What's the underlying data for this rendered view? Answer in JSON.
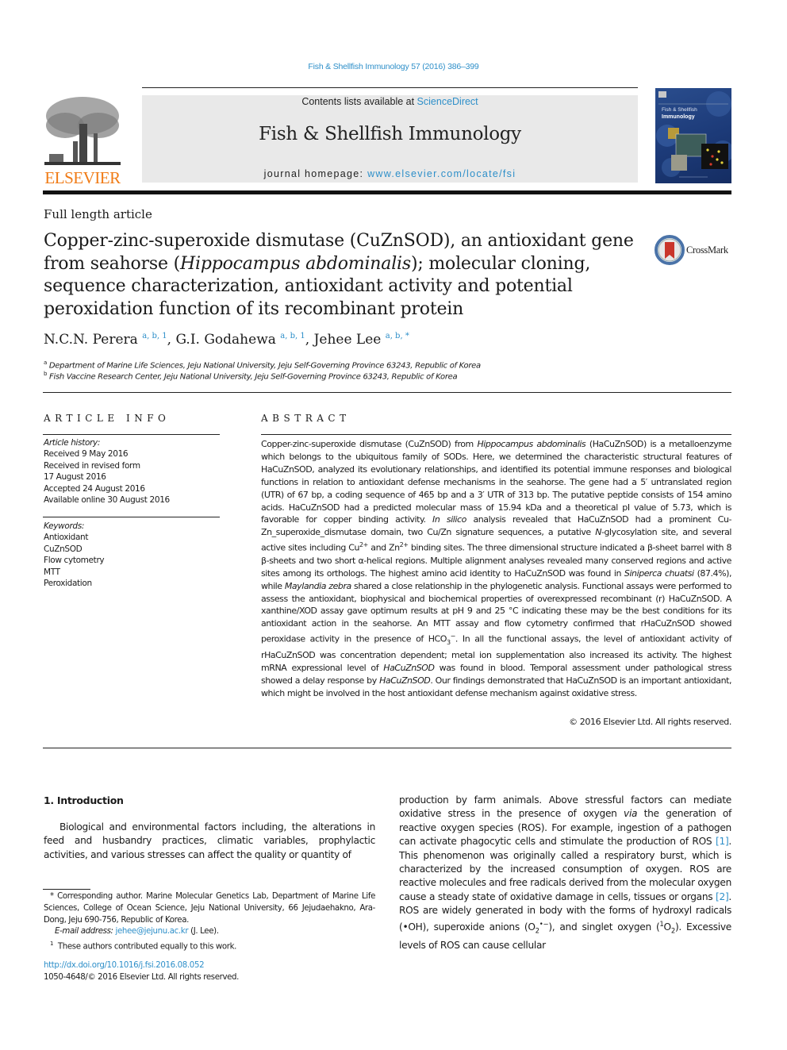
{
  "header": {
    "citation": "Fish & Shellfish Immunology 57 (2016) 386–399",
    "publisher_logo": "elsevier-tree-logo",
    "publisher_name": "ELSEVIER",
    "contents_prefix": "Contents lists available at ",
    "contents_link": "ScienceDirect",
    "journal_name": "Fish & Shellfish Immunology",
    "homepage_prefix": "journal homepage: ",
    "homepage_link": "www.elsevier.com/locate/fsi",
    "cover_title_line1": "Fish & Shellfish",
    "cover_title_line2": "Immunology",
    "colors": {
      "link": "#2e8fc9",
      "elsevier_orange": "#f07b16",
      "cover_blue": "#1c3a78",
      "header_box": "#e9e9e9"
    }
  },
  "article": {
    "type": "Full length article",
    "title_part1": "Copper-zinc-superoxide dismutase (CuZnSOD), an antioxidant gene from seahorse (",
    "title_italic": "Hippocampus abdominalis",
    "title_part2": "); molecular cloning, sequence characterization, antioxidant activity and potential peroxidation function of its recombinant protein",
    "crossmark_label": "CrossMark",
    "authors": [
      {
        "name": "N.C.N. Perera",
        "marks": "a, b, 1"
      },
      {
        "name": "G.I. Godahewa",
        "marks": "a, b, 1"
      },
      {
        "name": "Jehee Lee",
        "marks": "a, b, *"
      }
    ],
    "affiliations": [
      {
        "mark": "a",
        "text": "Department of Marine Life Sciences, Jeju National University, Jeju Self-Governing Province 63243, Republic of Korea"
      },
      {
        "mark": "b",
        "text": "Fish Vaccine Research Center, Jeju National University, Jeju Self-Governing Province 63243, Republic of Korea"
      }
    ]
  },
  "article_info": {
    "heading": "ARTICLE INFO",
    "history_label": "Article history:",
    "history": [
      "Received 9 May 2016",
      "Received in revised form",
      "17 August 2016",
      "Accepted 24 August 2016",
      "Available online 30 August 2016"
    ],
    "keywords_label": "Keywords:",
    "keywords": [
      "Antioxidant",
      "CuZnSOD",
      "Flow cytometry",
      "MTT",
      "Peroxidation"
    ]
  },
  "abstract": {
    "heading": "ABSTRACT",
    "segments": [
      {
        "t": "Copper-zinc-superoxide dismutase (CuZnSOD) from "
      },
      {
        "t": "Hippocampus abdominalis",
        "i": true
      },
      {
        "t": " (HaCuZnSOD) is a metalloenzyme which belongs to the ubiquitous family of SODs. Here, we determined the characteristic structural features of HaCuZnSOD, analyzed its evolutionary relationships, and identified its potential immune responses and biological functions in relation to antioxidant defense mechanisms in the seahorse. The gene had a 5′ untranslated region (UTR) of 67 bp, a coding sequence of 465 bp and a 3′ UTR of 313 bp. The putative peptide consists of 154 amino acids. HaCuZnSOD had a predicted molecular mass of 15.94 kDa and a theoretical p"
      },
      {
        "t": "I",
        "i": false
      },
      {
        "t": " value of 5.73, which is favorable for copper binding activity. "
      },
      {
        "t": "In silico",
        "i": true
      },
      {
        "t": " analysis revealed that HaCuZnSOD had a prominent Cu-Zn_superoxide_dismutase domain, two Cu/Zn signature sequences, a putative "
      },
      {
        "t": "N",
        "i": true
      },
      {
        "t": "-glycosylation site, and several active sites including Cu"
      },
      {
        "t": "2+",
        "sup": true
      },
      {
        "t": " and Zn"
      },
      {
        "t": "2+",
        "sup": true
      },
      {
        "t": " binding sites. The three dimensional structure indicated a β-sheet barrel with 8 β-sheets and two short α-helical regions. Multiple alignment analyses revealed many conserved regions and active sites among its orthologs. The highest amino acid identity to HaCuZnSOD was found in "
      },
      {
        "t": "Siniperca chuatsi",
        "i": true
      },
      {
        "t": " (87.4%), while "
      },
      {
        "t": "Maylandia zebra",
        "i": true
      },
      {
        "t": " shared a close relationship in the phylogenetic analysis. Functional assays were performed to assess the antioxidant, biophysical and biochemical properties of overexpressed recombinant (r) HaCuZnSOD. A xanthine/XOD assay gave optimum results at pH 9 and 25 °C indicating these may be the best conditions for its antioxidant action in the seahorse. An MTT assay and flow cytometry confirmed that rHaCuZnSOD showed peroxidase activity in the presence of HCO"
      },
      {
        "t": "3",
        "sub": true
      },
      {
        "t": "−",
        "sup": true
      },
      {
        "t": ". In all the functional assays, the level of antioxidant activity of rHaCuZnSOD was concentration dependent; metal ion supplementation also increased its activity. The highest mRNA expressional level of "
      },
      {
        "t": "HaCuZnSOD",
        "i": true
      },
      {
        "t": " was found in blood. Temporal assessment under pathological stress showed a delay response by "
      },
      {
        "t": "HaCuZnSOD",
        "i": true
      },
      {
        "t": ". Our findings demonstrated that HaCuZnSOD is an important antioxidant, which might be involved in the host antioxidant defense mechanism against oxidative stress."
      }
    ],
    "copyright": "© 2016 Elsevier Ltd. All rights reserved."
  },
  "body": {
    "section_heading": "1.  Introduction",
    "col1_paragraph": "Biological and environmental factors including, the alterations in feed and husbandry practices, climatic variables, prophylactic activities, and various stresses can affect the quality or quantity of",
    "col2_segments": [
      {
        "t": "production by farm animals. Above stressful factors can mediate oxidative stress in the presence of oxygen "
      },
      {
        "t": "via",
        "i": true
      },
      {
        "t": " the generation of reactive oxygen species (ROS). For example, ingestion of a pathogen can activate phagocytic cells and stimulate the production of ROS "
      },
      {
        "t": "[1]",
        "link": true
      },
      {
        "t": ". This phenomenon was originally called a respiratory burst, which is characterized by the increased consumption of oxygen. ROS are reactive molecules and free radicals derived from the molecular oxygen cause a steady state of oxidative damage in cells, tissues or organs "
      },
      {
        "t": "[2]",
        "link": true
      },
      {
        "t": ". ROS are widely generated in body with the forms of hydroxyl radicals (•OH), superoxide anions (O"
      },
      {
        "t": "2",
        "sub": true
      },
      {
        "t": "•−",
        "sup": true
      },
      {
        "t": "), and singlet oxygen ("
      },
      {
        "t": "1",
        "sup": true
      },
      {
        "t": "O"
      },
      {
        "t": "2",
        "sub": true
      },
      {
        "t": "). Excessive levels of ROS can cause cellular"
      }
    ]
  },
  "footnotes": {
    "corresponding": "* Corresponding author. Marine Molecular Genetics Lab, Department of Marine Life Sciences, College of Ocean Science, Jeju National University, 66 Jejudaehakno, Ara-Dong, Jeju 690-756, Republic of Korea.",
    "email_label": "E-mail address: ",
    "email": "jehee@jejunu.ac.kr",
    "email_suffix": " (J. Lee).",
    "equal_mark": "1",
    "equal_text": "These authors contributed equally to this work.",
    "doi": "http://dx.doi.org/10.1016/j.fsi.2016.08.052",
    "issn_line": "1050-4648/© 2016 Elsevier Ltd. All rights reserved."
  }
}
